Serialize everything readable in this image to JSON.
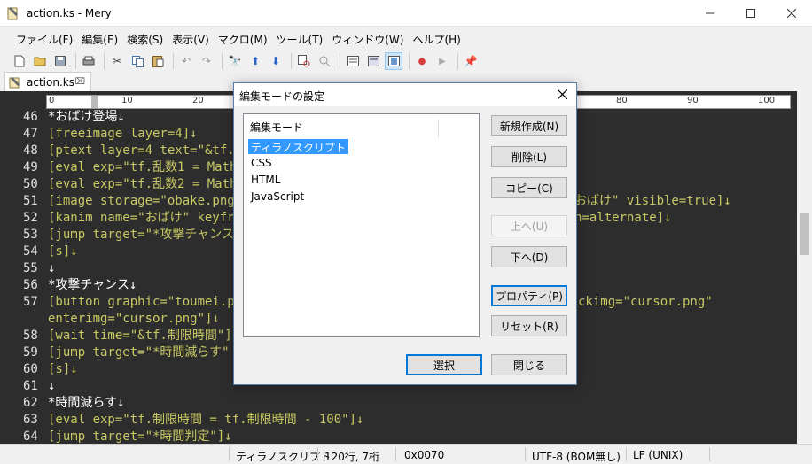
{
  "window": {
    "title": "action.ks - Mery"
  },
  "menu": [
    "ファイル(F)",
    "編集(E)",
    "検索(S)",
    "表示(V)",
    "マクロ(M)",
    "ツール(T)",
    "ウィンドウ(W)",
    "ヘルプ(H)"
  ],
  "toolbar_icons": [
    "new-file-icon",
    "open-folder-icon",
    "save-icon",
    "print-icon",
    "cut-icon",
    "copy-icon",
    "paste-icon",
    "undo-icon",
    "redo-icon",
    "find-icon",
    "find-up-icon",
    "find-down-icon",
    "replace-icon",
    "search-files-icon",
    "view-icon",
    "view-icon",
    "view-icon",
    "record-icon",
    "play-icon",
    "pin-icon"
  ],
  "tab": {
    "label": "action.ks",
    "close": "⌧"
  },
  "ruler": [
    "0",
    "10",
    "20",
    "80",
    "90",
    "100"
  ],
  "editor": {
    "lines": [
      {
        "num": "46",
        "text": "*おばけ登場↓",
        "kind": "plain"
      },
      {
        "num": "47",
        "text": "[freeimage layer=4]↓",
        "kind": "tag"
      },
      {
        "num": "48",
        "text": "[ptext layer=4 text=\"&tf.ス",
        "kind": "tag"
      },
      {
        "num": "49",
        "text": "[eval exp=\"tf.乱数1 = Math",
        "kind": "tag"
      },
      {
        "num": "50",
        "text": "[eval exp=\"tf.乱数2 = Math",
        "kind": "tag"
      },
      {
        "num": "51",
        "text": "[image storage=\"obake.png\"",
        "kind": "tag"
      },
      {
        "num": "52",
        "text": "[kanim name=\"おばけ\" keyfra",
        "kind": "tag"
      },
      {
        "num": "53",
        "text": "[jump target=\"*攻撃チャンス",
        "kind": "tag"
      },
      {
        "num": "54",
        "text": "[s]↓",
        "kind": "tag"
      },
      {
        "num": "55",
        "text": "↓",
        "kind": "plain"
      },
      {
        "num": "56",
        "text": "*攻撃チャンス↓",
        "kind": "plain"
      },
      {
        "num": "57",
        "text": "[button graphic=\"toumei.pna",
        "kind": "tag"
      },
      {
        "num": "",
        "text": "enterimg=\"cursor.png\"]↓",
        "kind": "tag"
      },
      {
        "num": "58",
        "text": "[wait time=\"&tf.制限時間\"]",
        "kind": "tag"
      },
      {
        "num": "59",
        "text": "[jump target=\"*時間減らす\"",
        "kind": "tag"
      },
      {
        "num": "60",
        "text": "[s]↓",
        "kind": "tag"
      },
      {
        "num": "61",
        "text": "↓",
        "kind": "plain"
      },
      {
        "num": "62",
        "text": "*時間減らす↓",
        "kind": "plain"
      },
      {
        "num": "63",
        "text": "[eval exp=\"tf.制限時間 = tf.制限時間 - 100\"]↓",
        "kind": "tag"
      },
      {
        "num": "64",
        "text": "[jump target=\"*時間判定\"]↓",
        "kind": "tag"
      }
    ],
    "right_fragments": [
      {
        "line": 5,
        "text": "おばけ\" visible=true]↓"
      },
      {
        "line": 6,
        "text": "n=alternate]↓"
      },
      {
        "line": 11,
        "text": "ckimg=\"cursor.png\""
      }
    ]
  },
  "dialog": {
    "title": "編集モードの設定",
    "list_header": "編集モード",
    "modes": [
      "ティラノスクリプト",
      "CSS",
      "HTML",
      "JavaScript"
    ],
    "selected": "ティラノスクリプト",
    "buttons": {
      "new": "新規作成(N)",
      "delete": "削除(L)",
      "copy": "コピー(C)",
      "up": "上へ(U)",
      "down": "下へ(D)",
      "properties": "プロパティ(P)",
      "reset": "リセット(R)",
      "select": "選択",
      "close": "閉じる"
    }
  },
  "status": {
    "mode": "ティラノスクリプト",
    "position": "120行, 7桁",
    "code": "0x0070",
    "encoding": "UTF-8 (BOM無し)",
    "newline": "LF (UNIX)"
  }
}
